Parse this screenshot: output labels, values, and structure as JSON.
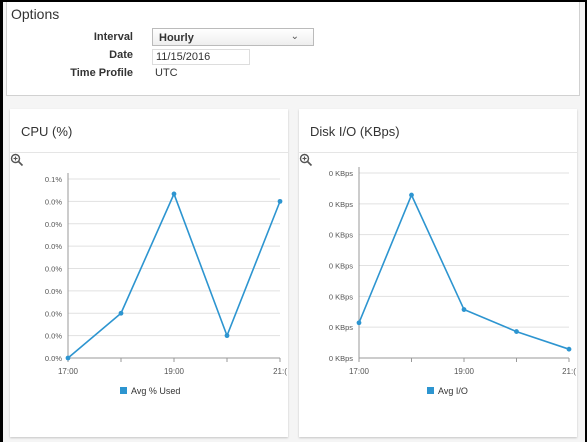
{
  "options": {
    "title": "Options",
    "interval_label": "Interval",
    "interval_value": "Hourly",
    "date_label": "Date",
    "date_value": "11/15/2016",
    "time_profile_label": "Time Profile",
    "time_profile_value": "UTC"
  },
  "colors": {
    "series": "#2d95d0",
    "grid": "#e1e1e1",
    "axis": "#555555"
  },
  "chart_data": [
    {
      "type": "line",
      "title": "CPU (%)",
      "x": [
        "17:00",
        "18:00",
        "19:00",
        "20:00",
        "21:00"
      ],
      "x_tick_labels": [
        "17:00",
        "19:00",
        "21:("
      ],
      "y_tick_labels": [
        "0.0%",
        "0.0%",
        "0.0%",
        "0.0%",
        "0.0%",
        "0.0%",
        "0.0%",
        "0.0%",
        "0.1%"
      ],
      "series": [
        {
          "name": "Avg % Used",
          "values": [
            0.0,
            0.03,
            0.11,
            0.015,
            0.105
          ]
        }
      ],
      "ylim": [
        0,
        0.12
      ],
      "legend": "bottom",
      "grid": true
    },
    {
      "type": "line",
      "title": "Disk I/O (KBps)",
      "x": [
        "17:00",
        "18:00",
        "19:00",
        "20:00",
        "21:00"
      ],
      "x_tick_labels": [
        "17:00",
        "19:00",
        "21:("
      ],
      "y_tick_labels": [
        "0 KBps",
        "0 KBps",
        "0 KBps",
        "0 KBps",
        "0 KBps",
        "0 KBps",
        "0 KBps"
      ],
      "series": [
        {
          "name": "Avg I/O",
          "values": [
            0.0008,
            0.0037,
            0.0011,
            0.0006,
            0.0002
          ]
        }
      ],
      "ylim": [
        0,
        0.0042
      ],
      "legend": "bottom",
      "grid": true
    }
  ]
}
